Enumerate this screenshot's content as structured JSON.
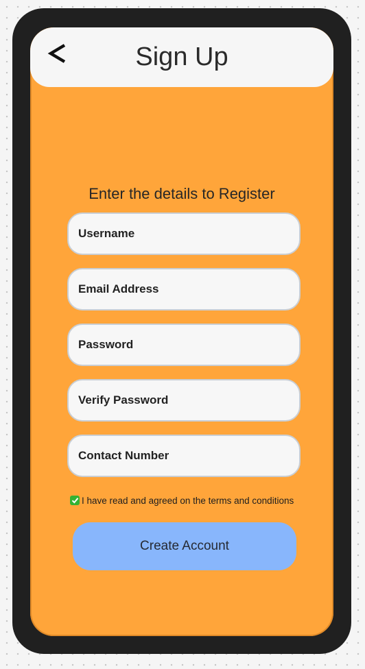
{
  "header": {
    "title": "Sign Up",
    "back_icon": "chevron-left-icon"
  },
  "form": {
    "subtitle": "Enter the details to Register",
    "fields": [
      {
        "placeholder": "Username"
      },
      {
        "placeholder": "Email Address"
      },
      {
        "placeholder": "Password"
      },
      {
        "placeholder": "Verify Password"
      },
      {
        "placeholder": "Contact Number"
      }
    ],
    "terms": {
      "checked": true,
      "label": "I have read and agreed on the terms and conditions"
    },
    "submit_label": "Create Account"
  },
  "colors": {
    "screen_bg": "#ffa53a",
    "header_bg": "#f6f6f6",
    "field_bg": "#f7f7f7",
    "button_bg": "#88b6fc",
    "checkbox": "#34b233",
    "device_frame": "#202020"
  }
}
